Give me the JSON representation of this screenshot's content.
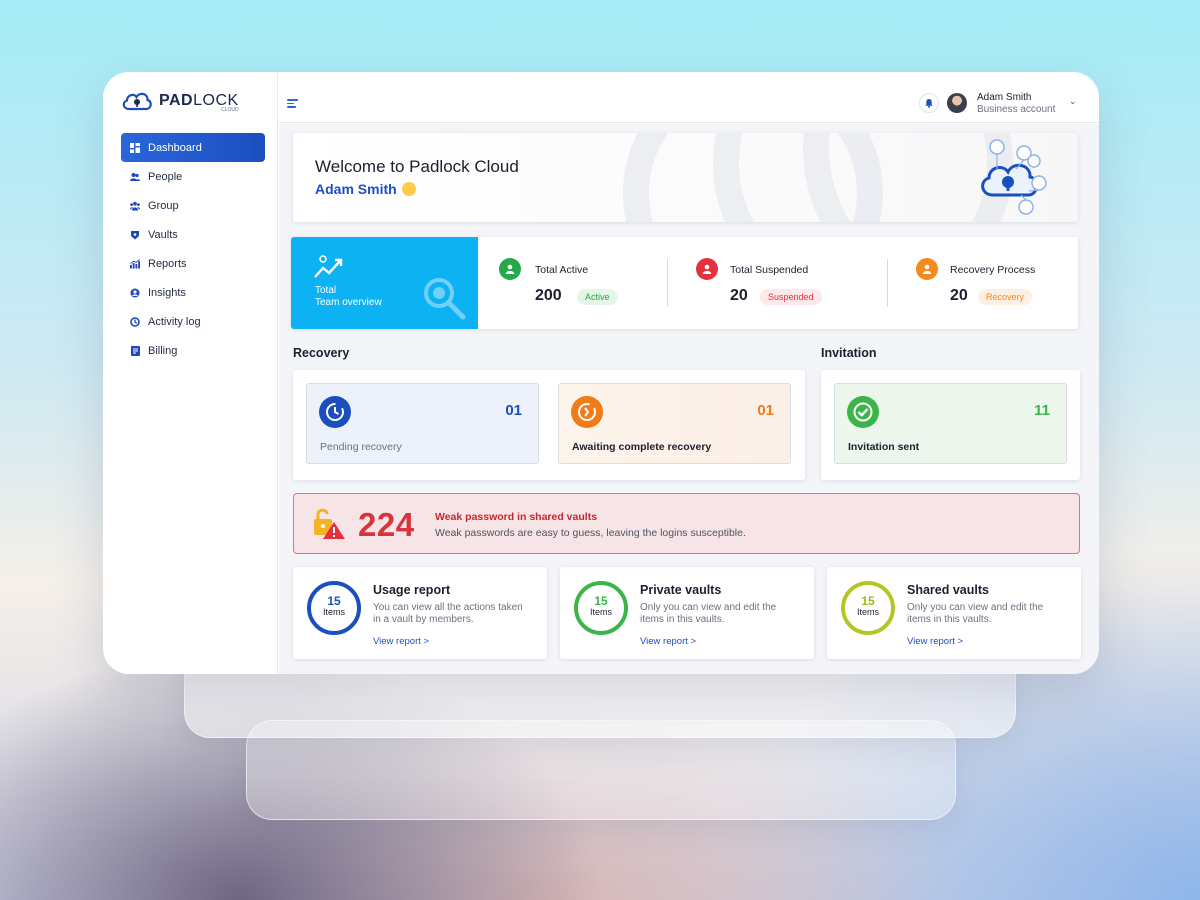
{
  "brand": {
    "name_bold": "PAD",
    "name_rest": "LOCK",
    "sub": "CLOUD",
    "accent": "#1b4fc0",
    "cyan": "#0db2f3"
  },
  "sidebar": {
    "items": [
      {
        "label": "Dashboard",
        "icon": "dashboard-icon",
        "active": true
      },
      {
        "label": "People",
        "icon": "people-icon"
      },
      {
        "label": "Group",
        "icon": "group-icon"
      },
      {
        "label": "Vaults",
        "icon": "vault-icon"
      },
      {
        "label": "Reports",
        "icon": "reports-icon"
      },
      {
        "label": "Insights",
        "icon": "insights-icon"
      },
      {
        "label": "Activity log",
        "icon": "activity-log-icon"
      },
      {
        "label": "Billing",
        "icon": "billing-icon"
      }
    ]
  },
  "header": {
    "user_name": "Adam Smith",
    "user_role": "Business account"
  },
  "welcome": {
    "title": "Welcome to Padlock Cloud",
    "user": "Adam Smith"
  },
  "stats": {
    "team_label_1": "Total",
    "team_label_2": "Team overview",
    "active": {
      "title": "Total Active",
      "value": "200",
      "badge": "Active",
      "color": "#27a84a"
    },
    "suspended": {
      "title": "Total Suspended",
      "value": "20",
      "badge": "Suspended",
      "color": "#e3323d"
    },
    "recovery": {
      "title": "Recovery Process",
      "value": "20",
      "badge": "Recovery",
      "color": "#f28a1c"
    }
  },
  "recovery": {
    "title": "Recovery",
    "pending": {
      "label": "Pending recovery",
      "value": "01"
    },
    "awaiting": {
      "label": "Awaiting complete recovery",
      "value": "01"
    }
  },
  "invitation": {
    "title": "Invitation",
    "sent": {
      "label": "Invitation sent",
      "value": "11"
    }
  },
  "alert": {
    "count": "224",
    "title": "Weak password in shared vaults",
    "desc": "Weak passwords are easy to guess, leaving the logins susceptible."
  },
  "reports": [
    {
      "value": "15",
      "unit": "Items",
      "title": "Usage report",
      "desc": "You can view all the actions taken in a vault by members.",
      "link": "View report >",
      "color": "#1b4fc0"
    },
    {
      "value": "15",
      "unit": "Items",
      "title": "Private vaults",
      "desc": "Only you can view and edit the items in this vaults.",
      "link": "View report >",
      "color": "#3bb54a"
    },
    {
      "value": "15",
      "unit": "Items",
      "title": "Shared vaults",
      "desc": "Only you can view and edit the items in this vaults.",
      "link": "View report >",
      "color": "#b4c526"
    }
  ]
}
